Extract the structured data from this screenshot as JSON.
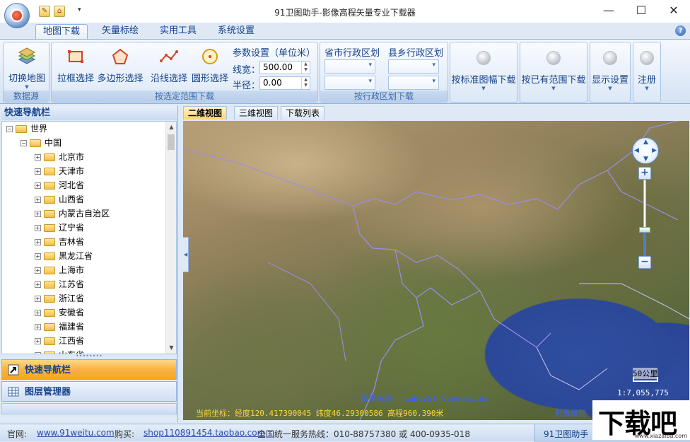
{
  "app": {
    "title": "91卫图助手-影像高程矢量专业下载器"
  },
  "quick_access": {
    "dropdown_glyph": "▾"
  },
  "window_controls": {
    "minimize": "—",
    "maximize": "☐",
    "close": "✕"
  },
  "ribbon_tabs": [
    "地图下载",
    "矢量标绘",
    "实用工具",
    "系统设置"
  ],
  "help_glyph": "?",
  "ribbon": {
    "datasource": {
      "button": "切换地图",
      "group": "数据源"
    },
    "range": {
      "group": "按选定范围下载",
      "rect": "拉框选择",
      "polygon": "多边形选择",
      "line": "沿线选择",
      "circle": "圆形选择",
      "params_title": "参数设置（单位米）",
      "line_width_label": "线宽：",
      "line_width_value": "500.00",
      "radius_label": "半径：",
      "radius_value": "0.00"
    },
    "admin": {
      "group": "按行政区划下载",
      "province_label": "省市行政区划",
      "county_label": "县乡行政区划"
    },
    "big_buttons": [
      "按标准图幅下载",
      "按已有范围下载",
      "显示设置",
      "注册"
    ]
  },
  "left_panel": {
    "header": "快速导航栏",
    "tree": {
      "root": "世界",
      "country": "中国",
      "provinces": [
        "北京市",
        "天津市",
        "河北省",
        "山西省",
        "内蒙古自治区",
        "辽宁省",
        "吉林省",
        "黑龙江省",
        "上海市",
        "江苏省",
        "浙江省",
        "安徽省",
        "福建省",
        "江西省",
        "山东省"
      ]
    },
    "nav_items": [
      "快速导航栏",
      "图层管理器"
    ]
  },
  "map_tabs": [
    "二维视图",
    "三维视图",
    "下载列表"
  ],
  "map": {
    "source": "影像来源：  Landsat Copernicus",
    "coords": "当前坐标：经度120.417390045 纬度46.29300586 高程960.390米",
    "scale_label": "50公里",
    "scale_ratio": "1:7,055,775",
    "level": "影像级别"
  },
  "status": {
    "site_label": "官网:",
    "site_url": "www.91weitu.com",
    "shop_label": "购买:",
    "shop_url": "shop110891454.taobao.com",
    "hotline": "全国统一服务热线：010-88757380 或 400-0935-018",
    "app_short": "91卫图助手"
  },
  "watermark": {
    "text": "下载吧",
    "url": "www.xiazaiba.com"
  },
  "colors": {
    "ribbon_blue": "#15428b",
    "active_nav": "#f8b340",
    "sea": "#2c4898"
  }
}
